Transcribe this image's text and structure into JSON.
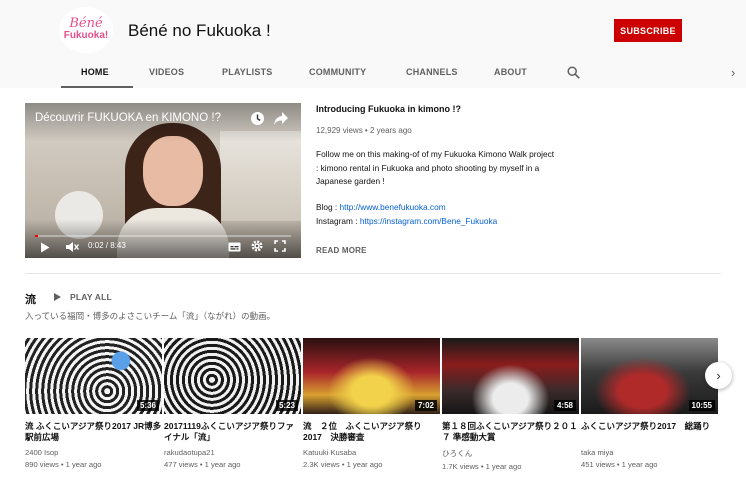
{
  "channel": {
    "avatar_line1": "Béné",
    "avatar_line2": "Fukuoka!",
    "name": "Béné no Fukuoka !",
    "subscribe_label": "SUBSCRIBE"
  },
  "tabs": [
    {
      "label": "HOME",
      "active": true
    },
    {
      "label": "VIDEOS"
    },
    {
      "label": "PLAYLISTS"
    },
    {
      "label": "COMMUNITY"
    },
    {
      "label": "CHANNELS"
    },
    {
      "label": "ABOUT"
    }
  ],
  "icons": {
    "search": "search-icon",
    "tabs_scroll": "chevron-right-icon",
    "shelf_next": "chevron-right-icon"
  },
  "featured": {
    "player_title": "Découvrir FUKUOKA en KIMONO !?",
    "time": "0:02 / 8:43",
    "progress": 0.004,
    "title": "Introducing Fukuoka in kimono !?",
    "meta": "12,929 views • 2 years ago",
    "description": "Follow me on this making-of of my Fukuoka Kimono Walk project  : kimono rental in Fukuoka and photo shooting by myself in a Japanese garden !",
    "blog_label": "Blog : ",
    "blog_url": "http://www.benefukuoka.com",
    "instagram_label": "Instagram : ",
    "instagram_url": "https://instagram.com/Bene_Fukuoka",
    "read_more": "READ MORE"
  },
  "shelf": {
    "title": "流",
    "play_all": "PLAY ALL",
    "description": "入っている福岡・博多のよさこいチーム「流」（ながれ）の動画。",
    "videos": [
      {
        "title": "流 ふくこいアジア祭り2017 JR博多駅前広場",
        "channel": "2400 Isop",
        "meta": "890 views • 1 year ago",
        "duration": "5:36"
      },
      {
        "title": "20171119ふくこいアジア祭りファイナル「流」",
        "channel": "rakudaotupa21",
        "meta": "477 views • 1 year ago",
        "duration": "5:23"
      },
      {
        "title": "流　２位　ふくこいアジア祭り2017　決勝審査",
        "channel": "Katuuki Kusaba",
        "meta": "2.3K views • 1 year ago",
        "duration": "7:02"
      },
      {
        "title": "第１８回ふくこいアジア祭り２０１７ 準感動大賞",
        "channel": "ひろくん",
        "meta": "1.7K views • 1 year ago",
        "duration": "4:58"
      },
      {
        "title": "ふくこいアジア祭り2017　総踊り",
        "channel": "taka miya",
        "meta": "451 views • 1 year ago",
        "duration": "10:55"
      }
    ]
  }
}
